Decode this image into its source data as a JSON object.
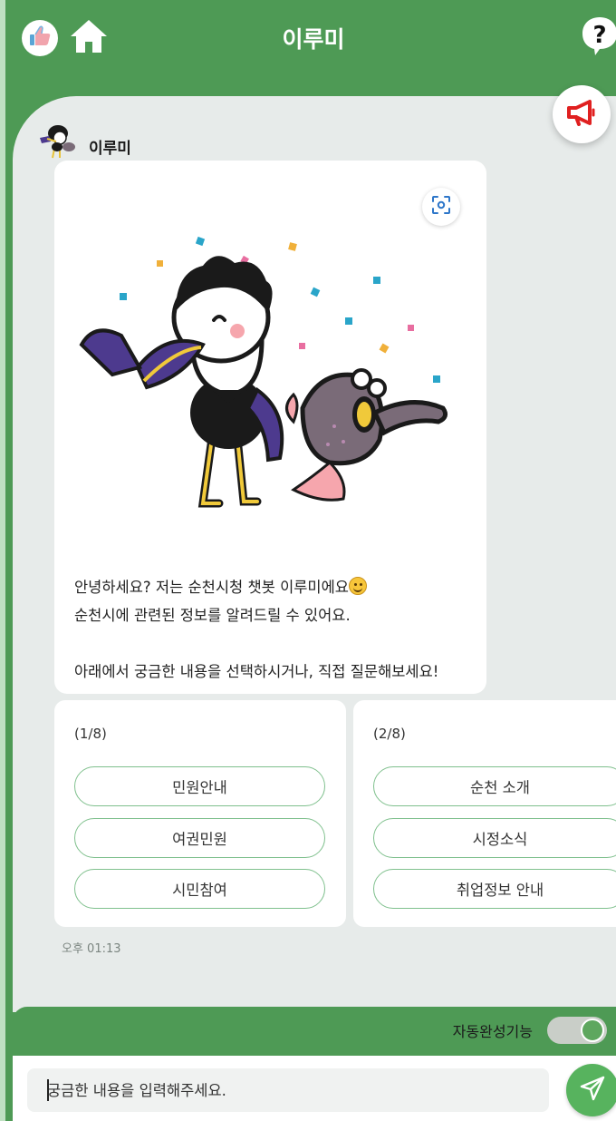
{
  "header": {
    "title": "이루미",
    "like_icon": "thumbs-up-icon",
    "home_icon": "home-icon",
    "help_icon": "question-mark-icon"
  },
  "announce_icon": "megaphone-icon",
  "bot": {
    "name": "이루미",
    "avatar_icon": "mascot-avatar-icon"
  },
  "message": {
    "scan_icon": "focus-scan-icon",
    "line1": "안녕하세요? 저는 순천시청 챗봇 이루미에요",
    "emoji": "smiley-face-icon",
    "line2": "순천시에 관련된 정보를 알려드릴 수 있어요.",
    "line3": "아래에서 궁금한 내용을 선택하시거나, 직접 질문해보세요!"
  },
  "quick_replies": [
    {
      "page": "(1/8)",
      "buttons": [
        "민원안내",
        "여권민원",
        "시민참여"
      ]
    },
    {
      "page": "(2/8)",
      "buttons": [
        "순천 소개",
        "시정소식",
        "취업정보 안내"
      ]
    }
  ],
  "timestamp": "오후 01:13",
  "footer": {
    "autocomplete_label": "자동완성기능",
    "autocomplete_on": true,
    "input_placeholder": "궁금한 내용을 입력해주세요.",
    "send_icon": "send-icon"
  },
  "colors": {
    "primary_green": "#4e9a55",
    "panel_bg": "#e7ebea",
    "button_border": "#7fc08d",
    "send_green": "#57b35e",
    "announce_red": "#e02020"
  }
}
